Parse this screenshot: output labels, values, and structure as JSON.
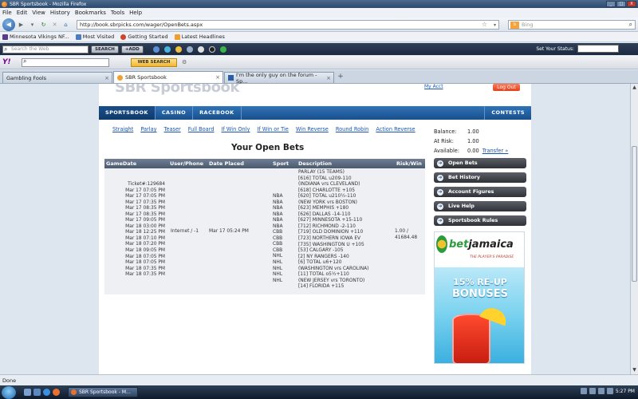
{
  "window": {
    "title": "SBR Sportsbook - Mozilla Firefox",
    "buttons": [
      "_",
      "□",
      "X"
    ]
  },
  "menubar": {
    "items": [
      "File",
      "Edit",
      "View",
      "History",
      "Bookmarks",
      "Tools",
      "Help"
    ]
  },
  "navbar": {
    "url": "http://book.sbrpicks.com/wager/OpenBets.aspx",
    "search_placeholder": "Bing",
    "search_engine": "b"
  },
  "bookmarks": [
    {
      "label": "Minnesota Vikings NF...",
      "color": "#5a3a8e"
    },
    {
      "label": "Most Visited",
      "color": "#4a7cc2"
    },
    {
      "label": "Getting Started",
      "color": "#d0452c"
    },
    {
      "label": "Latest Headlines",
      "color": "#f0a030"
    }
  ],
  "toolbar1": {
    "search_placeholder": "Search the Web",
    "search_btn": "SEARCH",
    "sub_btn": "+ADD",
    "status_label": "Set Your Status:"
  },
  "toolbar2": {
    "logo": "Y!",
    "web_search_btn": "WEB SEARCH"
  },
  "tabs": [
    {
      "label": "Gambling Fools",
      "active": false
    },
    {
      "label": "SBR Sportsbook",
      "active": true
    },
    {
      "label": "I'm the only guy on the forum - Sp...",
      "active": false
    }
  ],
  "page": {
    "logo": "SBR Sportsbook",
    "my_account": "My Acct",
    "logout": "Log Out",
    "mainnav": [
      "SPORTSBOOK",
      "CASINO",
      "RACEBOOK"
    ],
    "contests": "CONTESTS",
    "subnav": [
      "Straight",
      "Parlay",
      "Teaser",
      "Full Board",
      "If Win Only",
      "If Win or Tie",
      "Win Reverse",
      "Round Robin",
      "Action Reverse"
    ],
    "account": {
      "balance_label": "Balance:",
      "balance": "1.00",
      "atrisk_label": "At Risk:",
      "atrisk": "1.00",
      "available_label": "Available:",
      "available": "0.00",
      "transfer": "Transfer »"
    },
    "heading": "Your Open Bets",
    "table": {
      "headers": [
        "GameDate",
        "User/Phone",
        "Date Placed",
        "Sport",
        "Description",
        "Risk/Win"
      ],
      "ticket": "Ticket#:129684",
      "gamedates": [
        "Mar 17 07:05 PM",
        "Mar 17 07:05 PM",
        "Mar 17 07:35 PM",
        "Mar 17 08:35 PM",
        "Mar 17 08:35 PM",
        "Mar 17 09:05 PM",
        "Mar 18 03:00 PM",
        "Mar 18 12:25 PM",
        "Mar 18 07:10 PM",
        "Mar 18 07:20 PM",
        "Mar 18 09:05 PM",
        "Mar 18 07:05 PM",
        "Mar 18 07:05 PM",
        "Mar 18 07:35 PM",
        "Mar 18 07:35 PM"
      ],
      "user_phone": "Internet / -1",
      "date_placed": "Mar 17 05:24 PM",
      "sports": [
        "NBA",
        "NBA",
        "NBA",
        "NBA",
        "NBA",
        "NBA",
        "CBB",
        "CBB",
        "CBB",
        "CBB",
        "NHL",
        "NHL",
        "NHL",
        "NHL",
        "NHL"
      ],
      "description": [
        "PARLAY (15 TEAMS)",
        "[616] TOTAL u209-110",
        "(INDIANA vrs CLEVELAND)",
        "[618] CHARLOTTE +105",
        "[620] TOTAL u210½-110",
        "(NEW YORK vrs BOSTON)",
        "[623] MEMPHIS +180",
        "[626] DALLAS -14-110",
        "[627] MINNESOTA +15-110",
        "[712] RICHMOND -2-110",
        "[719] OLD DOMINION +110",
        "[723] NORTHERN IOWA EV",
        "[735] WASHINGTON U +105",
        "[53] CALGARY -105",
        "[2] NY RANGERS -140",
        "[6] TOTAL u6+120",
        "(WASHINGTON vrs CAROLINA)",
        "[11] TOTAL o5½+110",
        "(NEW JERSEY vrs TORONTO)",
        "[14] FLORIDA +115"
      ],
      "risk_win": [
        "1.00 /",
        "41684.48"
      ]
    },
    "sidebar": [
      "Open Bets",
      "Bet History",
      "Account Figures",
      "Live Help",
      "Sportsbook Rules"
    ],
    "ad": {
      "brand_a": "bet",
      "brand_b": "jamaica",
      "tagline": "THE PLAYER'S PARADISE",
      "promo_1": "15% RE-UP",
      "promo_2": "BONUSES"
    }
  },
  "statusbar": {
    "text": "Done"
  },
  "taskbar": {
    "task": "SBR Sportsbook - M...",
    "clock": "5:27 PM"
  }
}
